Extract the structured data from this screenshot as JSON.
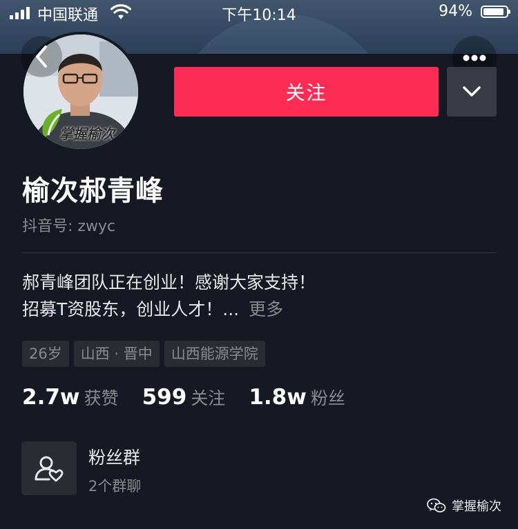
{
  "status_bar": {
    "carrier": "中国联通",
    "time": "下午10:14",
    "battery_percent": "94%"
  },
  "avatar": {
    "caption": "掌握榆次"
  },
  "actions": {
    "follow_label": "关注"
  },
  "profile": {
    "name": "榆次郝青峰",
    "douyin_id": "抖音号: zwyc",
    "bio_line1": "郝青峰团队正在创业！感谢大家支持！",
    "bio_line2": "招募T资股东，创业人才！...",
    "bio_more": "更多",
    "tags": [
      "26岁",
      "山西 · 晋中",
      "山西能源学院"
    ]
  },
  "stats": {
    "likes_value": "2.7w",
    "likes_label": "获赞",
    "following_value": "599",
    "following_label": "关注",
    "fans_value": "1.8w",
    "fans_label": "粉丝"
  },
  "fan_group": {
    "title": "粉丝群",
    "subtitle": "2个群聊"
  },
  "watermark": {
    "text": "掌握榆次"
  },
  "colors": {
    "background": "#161823",
    "follow_button": "#fe2c55",
    "secondary_text": "#8a8b91"
  }
}
